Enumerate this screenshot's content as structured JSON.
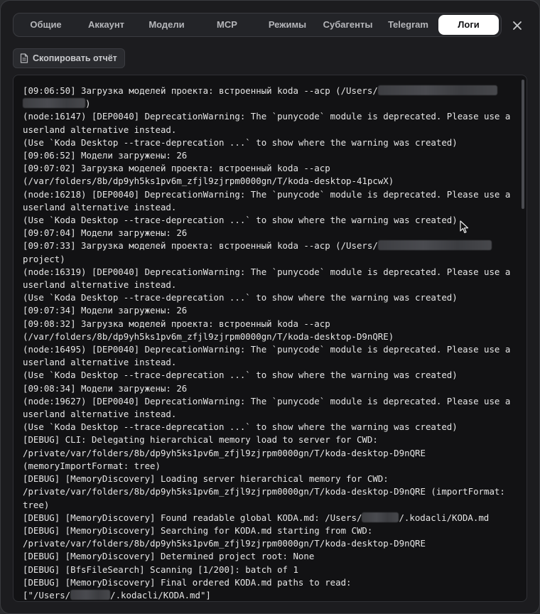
{
  "tabs": [
    {
      "label": "Общие",
      "active": false
    },
    {
      "label": "Аккаунт",
      "active": false
    },
    {
      "label": "Модели",
      "active": false
    },
    {
      "label": "MCP",
      "active": false
    },
    {
      "label": "Режимы",
      "active": false
    },
    {
      "label": "Субагенты",
      "active": false
    },
    {
      "label": "Telegram",
      "active": false
    },
    {
      "label": "Логи",
      "active": true
    }
  ],
  "toolbar": {
    "copy_report_label": "Скопировать отчёт"
  },
  "icons": {
    "close": "close-icon",
    "copy": "document-icon"
  },
  "colors": {
    "background": "#1c1c1f",
    "tab_active_bg": "#ffffff",
    "log_bg": "#121214",
    "log_text": "#e6e6e6"
  },
  "logs": {
    "lines": [
      "[09:06:50] Загрузка моделей проекта: встроенный koda --acp (/Users/",
      ")",
      "(node:16147) [DEP0040] DeprecationWarning: The `punycode` module is deprecated. Please use a",
      "userland alternative instead.",
      "(Use `Koda Desktop --trace-deprecation ...` to show where the warning was created)",
      "[09:06:52] Модели загружены: 26",
      "[09:07:02] Загрузка моделей проекта: встроенный koda --acp",
      "(/var/folders/8b/dp9yh5ks1pv6m_zfjl9zjrpm0000gn/T/koda-desktop-41pcwX)",
      "(node:16218) [DEP0040] DeprecationWarning: The `punycode` module is deprecated. Please use a",
      "userland alternative instead.",
      "(Use `Koda Desktop --trace-deprecation ...` to show where the warning was created)",
      "[09:07:04] Модели загружены: 26",
      "[09:07:33] Загрузка моделей проекта: встроенный koda --acp (/Users/",
      "project)",
      "(node:16319) [DEP0040] DeprecationWarning: The `punycode` module is deprecated. Please use a",
      "userland alternative instead.",
      "(Use `Koda Desktop --trace-deprecation ...` to show where the warning was created)",
      "[09:07:34] Модели загружены: 26",
      "[09:08:32] Загрузка моделей проекта: встроенный koda --acp",
      "(/var/folders/8b/dp9yh5ks1pv6m_zfjl9zjrpm0000gn/T/koda-desktop-D9nQRE)",
      "(node:16495) [DEP0040] DeprecationWarning: The `punycode` module is deprecated. Please use a",
      "userland alternative instead.",
      "(Use `Koda Desktop --trace-deprecation ...` to show where the warning was created)",
      "[09:08:34] Модели загружены: 26",
      "(node:19627) [DEP0040] DeprecationWarning: The `punycode` module is deprecated. Please use a",
      "userland alternative instead.",
      "(Use `Koda Desktop --trace-deprecation ...` to show where the warning was created)",
      "[DEBUG] CLI: Delegating hierarchical memory load to server for CWD:",
      "/private/var/folders/8b/dp9yh5ks1pv6m_zfjl9zjrpm0000gn/T/koda-desktop-D9nQRE",
      "(memoryImportFormat: tree)",
      "[DEBUG] [MemoryDiscovery] Loading server hierarchical memory for CWD:",
      "/private/var/folders/8b/dp9yh5ks1pv6m_zfjl9zjrpm0000gn/T/koda-desktop-D9nQRE (importFormat:",
      "tree)",
      "[DEBUG] [MemoryDiscovery] Found readable global KODA.md: /Users/",
      "/.kodacli/KODA.md",
      "[DEBUG] [MemoryDiscovery] Searching for KODA.md starting from CWD:",
      "/private/var/folders/8b/dp9yh5ks1pv6m_zfjl9zjrpm0000gn/T/koda-desktop-D9nQRE",
      "[DEBUG] [MemoryDiscovery] Determined project root: None",
      "[DEBUG] [BfsFileSearch] Scanning [1/200]: batch of 1",
      "[DEBUG] [MemoryDiscovery] Final ordered KODA.md paths to read:",
      "[\"/Users/",
      "/.kodacli/KODA.md\"]"
    ]
  }
}
